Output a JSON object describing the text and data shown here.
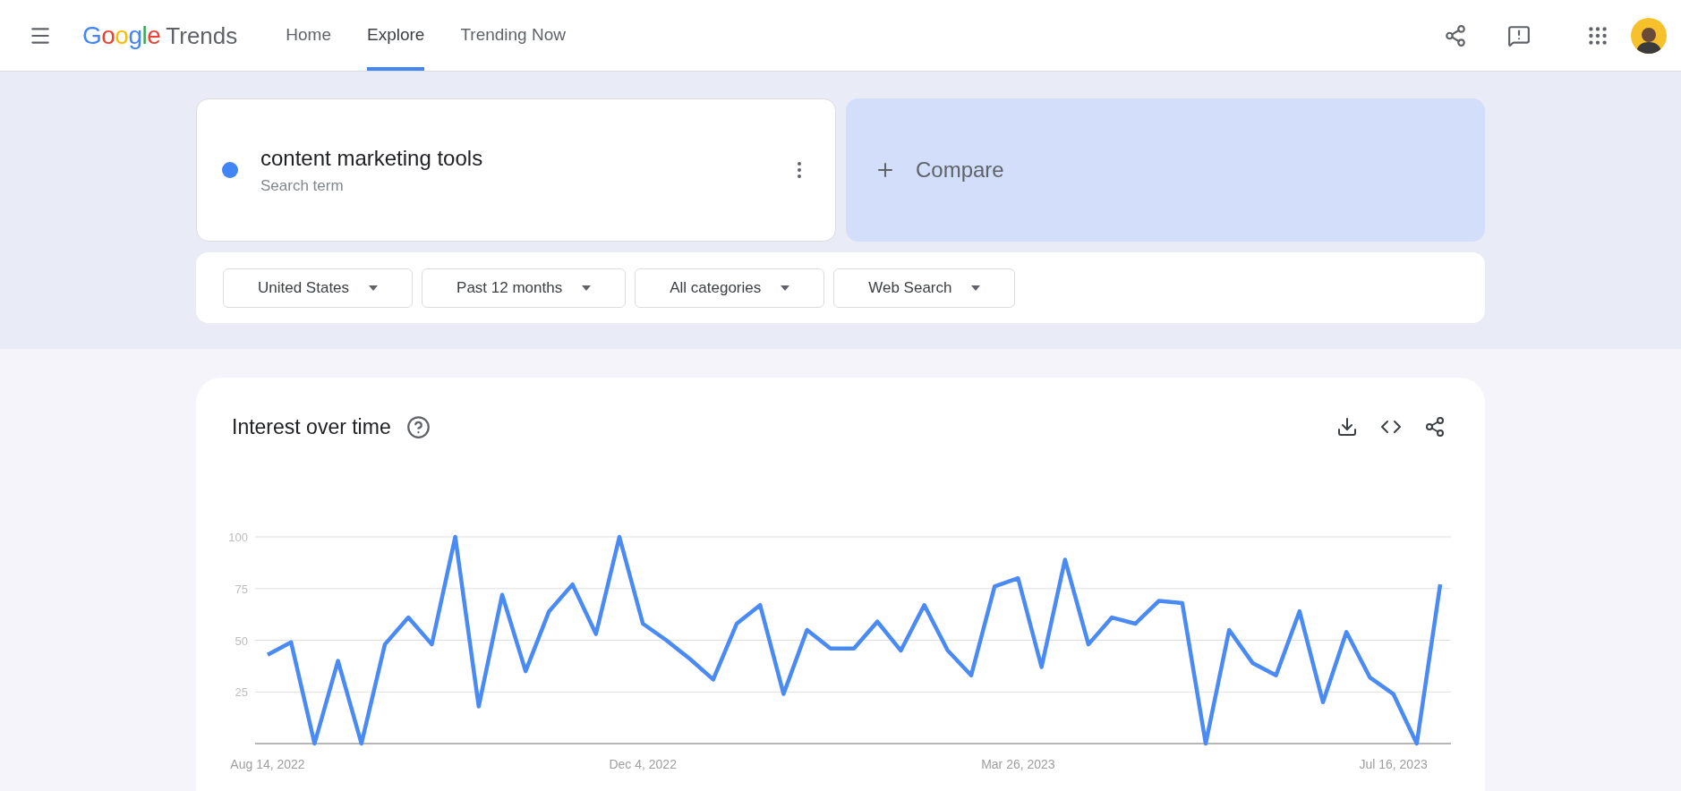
{
  "header": {
    "logo": {
      "brand": "Google",
      "product": "Trends"
    },
    "nav": [
      {
        "label": "Home",
        "selected": false
      },
      {
        "label": "Explore",
        "selected": true
      },
      {
        "label": "Trending Now",
        "selected": false
      }
    ]
  },
  "search_term": {
    "color": "#4285f4",
    "term": "content marketing tools",
    "subtitle": "Search term"
  },
  "compare": {
    "label": "Compare"
  },
  "filters": [
    "United States",
    "Past 12 months",
    "All categories",
    "Web Search"
  ],
  "interest_card": {
    "title": "Interest over time",
    "chart_data": {
      "type": "line",
      "categories": [
        "Aug 14, 2022",
        null,
        null,
        null,
        null,
        null,
        null,
        null,
        null,
        null,
        null,
        null,
        null,
        null,
        null,
        null,
        "Dec 4, 2022",
        null,
        null,
        null,
        null,
        null,
        null,
        null,
        null,
        null,
        null,
        null,
        null,
        null,
        null,
        null,
        "Mar 26, 2023",
        null,
        null,
        null,
        null,
        null,
        null,
        null,
        null,
        null,
        null,
        null,
        null,
        null,
        null,
        null,
        "Jul 16, 2023",
        null,
        null
      ],
      "series": [
        {
          "color": "#4a8af4",
          "values": [
            43,
            49,
            0,
            40,
            0,
            48,
            61,
            48,
            100,
            18,
            72,
            35,
            64,
            77,
            53,
            100,
            58,
            50,
            41,
            31,
            58,
            67,
            24,
            55,
            46,
            46,
            59,
            45,
            67,
            45,
            33,
            76,
            80,
            37,
            89,
            48,
            61,
            58,
            69,
            68,
            0,
            55,
            39,
            33,
            64,
            20,
            54,
            32,
            24,
            0,
            77
          ]
        }
      ],
      "ylim": [
        0,
        100
      ],
      "grid": true,
      "yticks": [
        25,
        50,
        75,
        100
      ]
    }
  }
}
